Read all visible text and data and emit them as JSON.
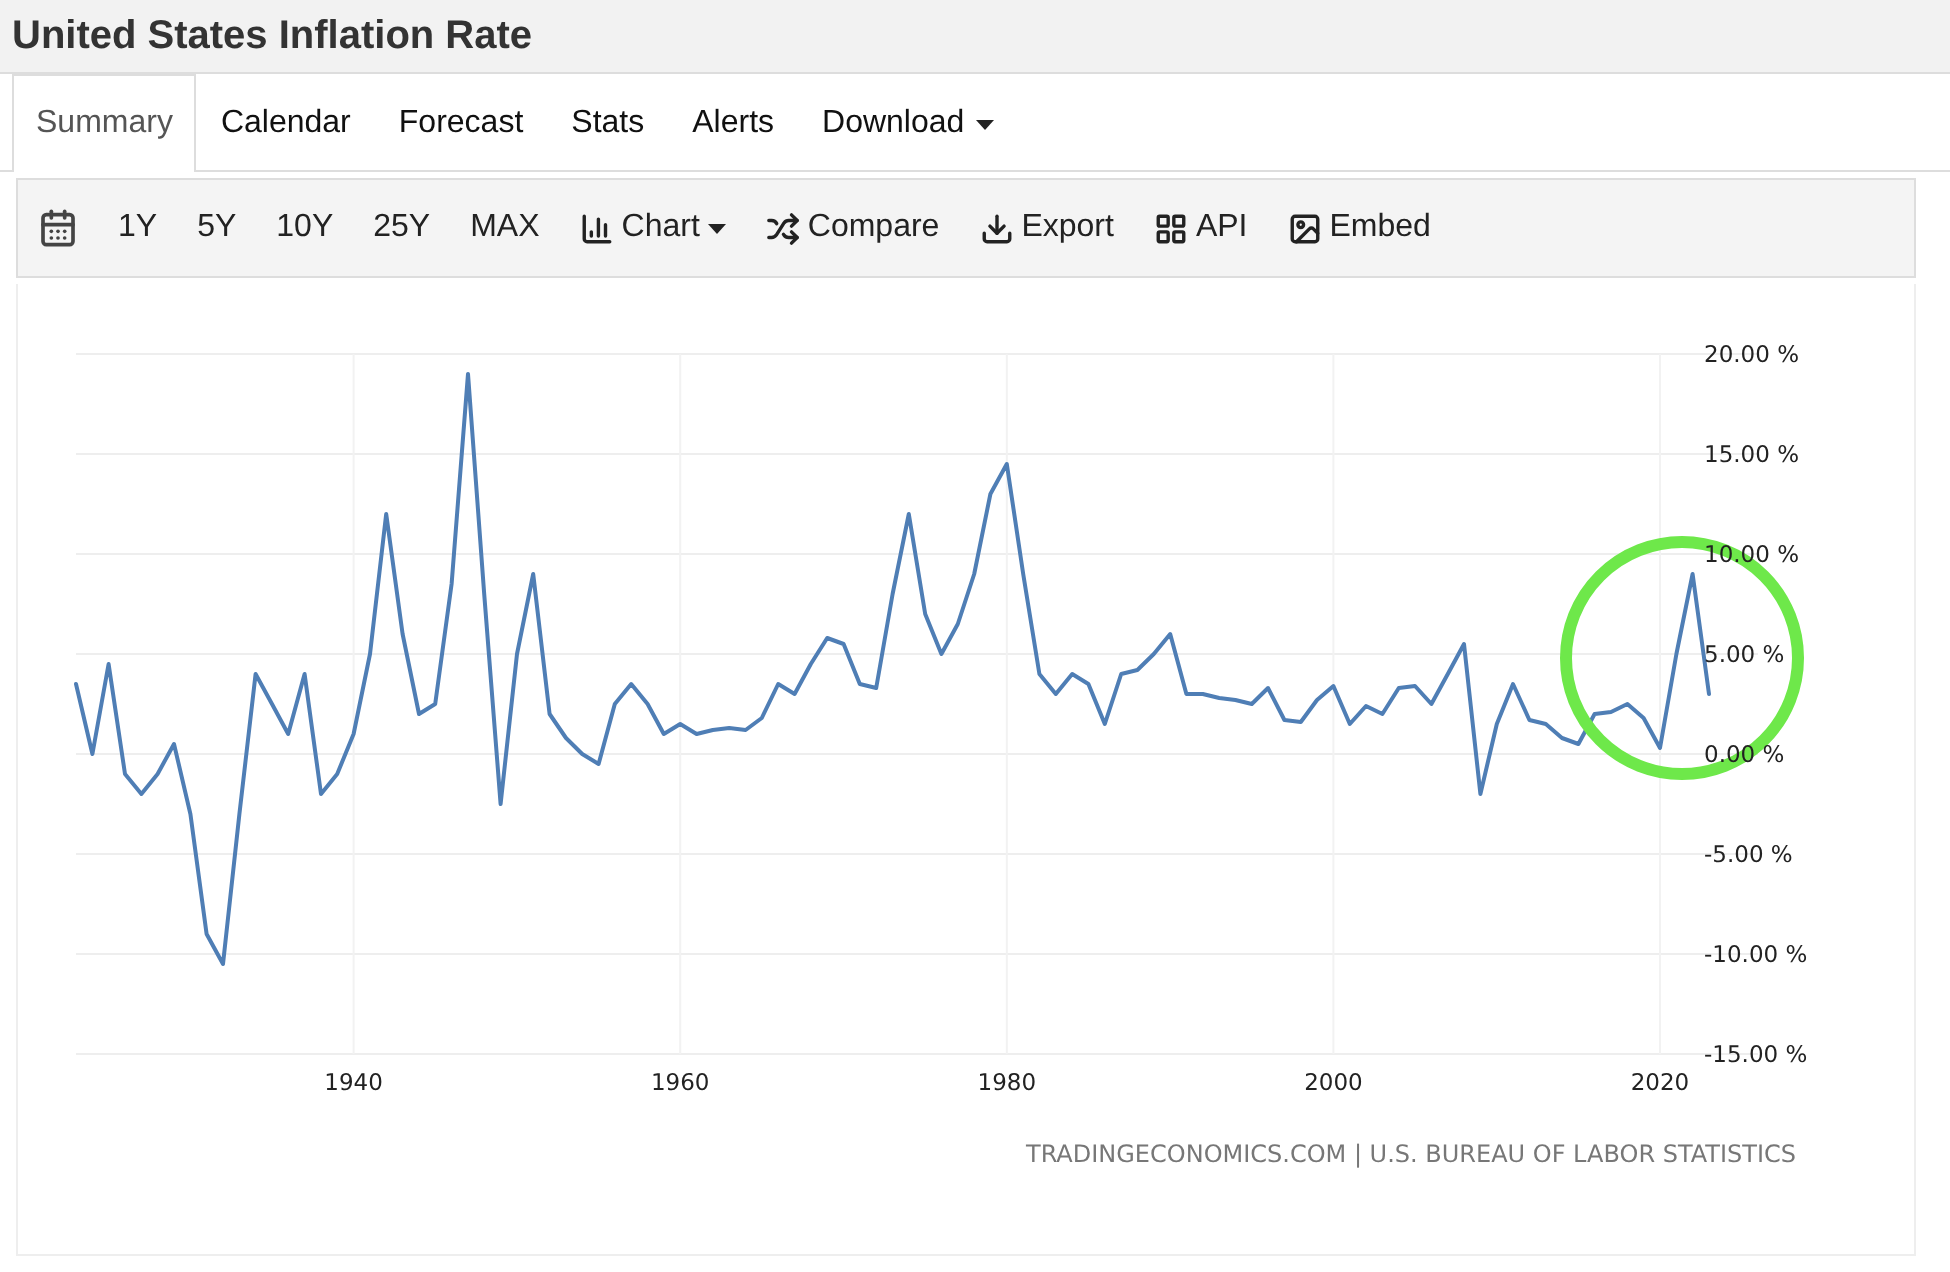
{
  "title": "United States Inflation Rate",
  "tabs": [
    {
      "label": "Summary",
      "selected": true,
      "dropdown": false
    },
    {
      "label": "Calendar",
      "selected": false,
      "dropdown": false
    },
    {
      "label": "Forecast",
      "selected": false,
      "dropdown": false
    },
    {
      "label": "Stats",
      "selected": false,
      "dropdown": false
    },
    {
      "label": "Alerts",
      "selected": false,
      "dropdown": false
    },
    {
      "label": "Download",
      "selected": false,
      "dropdown": true
    }
  ],
  "toolbar": {
    "ranges": [
      "1Y",
      "5Y",
      "10Y",
      "25Y",
      "MAX"
    ],
    "actions": [
      {
        "label": "Chart",
        "dropdown": true
      },
      {
        "label": "Compare",
        "dropdown": false
      },
      {
        "label": "Export",
        "dropdown": false
      },
      {
        "label": "API",
        "dropdown": false
      },
      {
        "label": "Embed",
        "dropdown": false
      }
    ]
  },
  "chart": {
    "source": "TRADINGECONOMICS.COM | U.S. BUREAU OF LABOR STATISTICS",
    "chart_data": {
      "type": "line",
      "x": [
        1923,
        1924,
        1925,
        1926,
        1927,
        1928,
        1929,
        1930,
        1931,
        1932,
        1933,
        1934,
        1935,
        1936,
        1937,
        1938,
        1939,
        1940,
        1941,
        1942,
        1943,
        1944,
        1945,
        1946,
        1947,
        1948,
        1949,
        1950,
        1951,
        1952,
        1953,
        1954,
        1955,
        1956,
        1957,
        1958,
        1959,
        1960,
        1961,
        1962,
        1963,
        1964,
        1965,
        1966,
        1967,
        1968,
        1969,
        1970,
        1971,
        1972,
        1973,
        1974,
        1975,
        1976,
        1977,
        1978,
        1979,
        1980,
        1981,
        1982,
        1983,
        1984,
        1985,
        1986,
        1987,
        1988,
        1989,
        1990,
        1991,
        1992,
        1993,
        1994,
        1995,
        1996,
        1997,
        1998,
        1999,
        2000,
        2001,
        2002,
        2003,
        2004,
        2005,
        2006,
        2007,
        2008,
        2009,
        2010,
        2011,
        2012,
        2013,
        2014,
        2015,
        2016,
        2017,
        2018,
        2019,
        2020,
        2021,
        2022,
        2023
      ],
      "series": [
        {
          "color": "#4f7eb5",
          "values": [
            3.5,
            0,
            4.5,
            -1,
            -2,
            -1,
            0.5,
            -3,
            -9,
            -10.5,
            -3,
            4,
            2.5,
            1,
            4,
            -2,
            -1,
            1,
            5,
            12,
            6,
            2,
            2.5,
            8.5,
            19,
            8,
            -2.5,
            5,
            9,
            2,
            0.8,
            0,
            -0.5,
            2.5,
            3.5,
            2.5,
            1,
            1.5,
            1,
            1.2,
            1.3,
            1.2,
            1.8,
            3.5,
            3,
            4.5,
            5.8,
            5.5,
            3.5,
            3.3,
            8,
            12,
            7,
            5,
            6.5,
            9,
            13,
            14.5,
            9,
            4,
            3,
            4,
            3.5,
            1.5,
            4,
            4.2,
            5,
            6,
            3,
            3,
            2.8,
            2.7,
            2.5,
            3.3,
            1.7,
            1.6,
            2.7,
            3.4,
            1.5,
            2.4,
            2,
            3.3,
            3.4,
            2.5,
            4,
            5.5,
            -2,
            1.5,
            3.5,
            1.7,
            1.5,
            0.8,
            0.5,
            2,
            2.1,
            2.5,
            1.8,
            0.3,
            5,
            9,
            3
          ]
        }
      ],
      "xlim": [
        1923,
        2026
      ],
      "ylim": [
        -15,
        20
      ],
      "grid": true,
      "xticks": [
        1940,
        1960,
        1980,
        2000,
        2020
      ],
      "yticks": [
        {
          "value": 20,
          "label": "20.00 %"
        },
        {
          "value": 15,
          "label": "15.00 %"
        },
        {
          "value": 10,
          "label": "10.00 %"
        },
        {
          "value": 5,
          "label": "5.00 %"
        },
        {
          "value": 0,
          "label": "0.00 %"
        },
        {
          "value": -5,
          "label": "-5.00 %"
        },
        {
          "value": -10,
          "label": "-10.00 %"
        },
        {
          "value": -15,
          "label": "-15.00 %"
        }
      ]
    },
    "highlight": {
      "color": "#6ee84a"
    }
  }
}
